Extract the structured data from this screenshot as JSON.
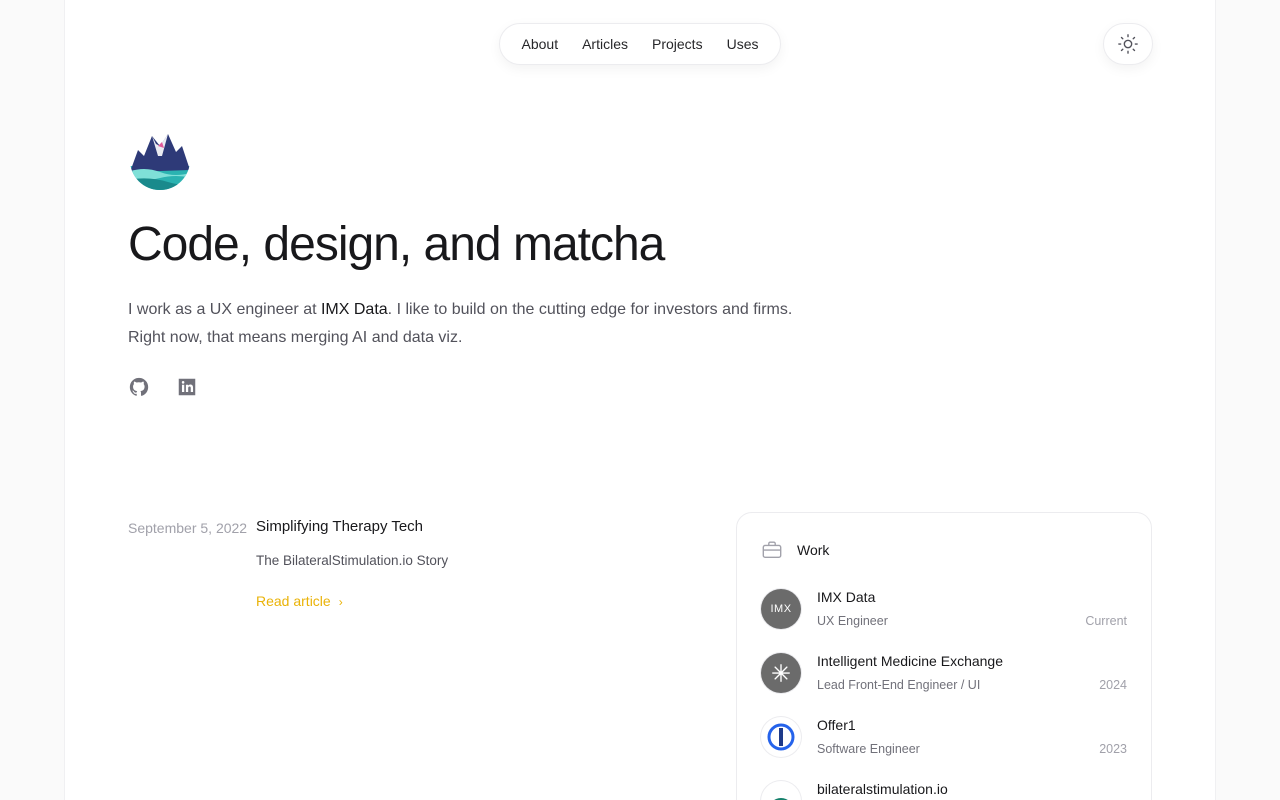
{
  "nav": {
    "items": [
      {
        "label": "About"
      },
      {
        "label": "Articles"
      },
      {
        "label": "Projects"
      },
      {
        "label": "Uses"
      }
    ],
    "theme_icon": "sun-icon"
  },
  "hero": {
    "logo_icon": "mountain-logo-icon",
    "headline": "Code, design, and matcha",
    "intro_before": "I work as a UX engineer at ",
    "intro_company": "IMX Data",
    "intro_after": ". I like to build on the cutting edge for investors and firms. Right now, that means merging AI and data viz.",
    "social": [
      {
        "icon": "github-icon"
      },
      {
        "icon": "linkedin-icon"
      }
    ]
  },
  "article": {
    "date": "September 5, 2022",
    "title": "Simplifying Therapy Tech",
    "subtitle": "The BilateralStimulation.io Story",
    "read_label": "Read article",
    "read_icon": "chevron-right-icon",
    "accent": "#eab308"
  },
  "work": {
    "title": "Work",
    "icon": "briefcase-icon",
    "jobs": [
      {
        "company": "IMX Data",
        "role": "UX Engineer",
        "year": "Current",
        "avatar_text": "IMX",
        "avatar_color": "#6b6b6b"
      },
      {
        "company": "Intelligent Medicine Exchange",
        "role": "Lead Front-End Engineer / UI",
        "year": "2024",
        "avatar_color": "#6b6b6b"
      },
      {
        "company": "Offer1",
        "role": "Software Engineer",
        "year": "2023",
        "avatar_color": "#2563eb"
      },
      {
        "company": "bilateralstimulation.io",
        "role": "",
        "year": "",
        "avatar_color": "#14806b"
      }
    ]
  }
}
